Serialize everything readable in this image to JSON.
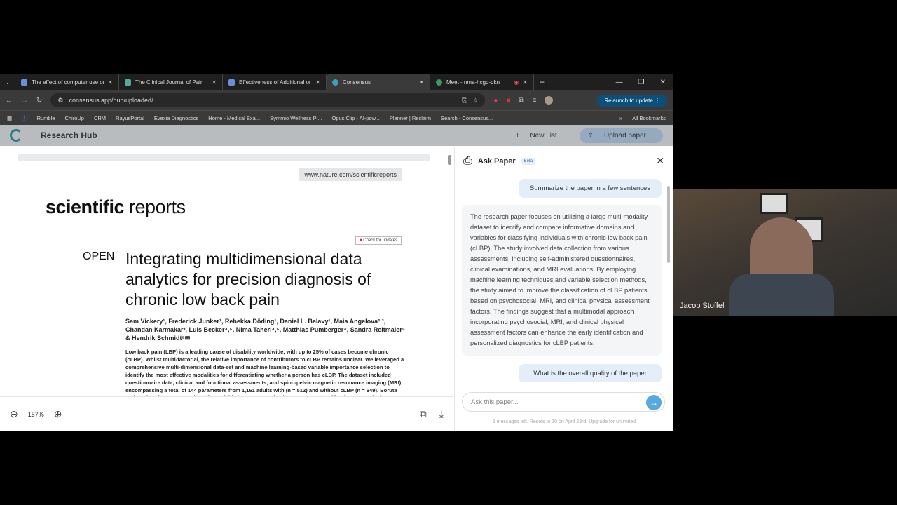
{
  "tabs": [
    {
      "title": "The effect of computer use on"
    },
    {
      "title": "The Clinical Journal of Pain"
    },
    {
      "title": "Effectiveness of Additional or S"
    },
    {
      "title": "Consensus"
    },
    {
      "title": "Meet - nma-hcgd-dkn"
    }
  ],
  "address": {
    "url": "consensus.app/hub/uploaded/",
    "relaunch": "Relaunch to update"
  },
  "bookmarks": [
    "Rumble",
    "ChiroUp",
    "CRM",
    "RayusPortal",
    "Evexia Diagnostics",
    "Home - Medical Exa...",
    "Symmio Wellness Pl...",
    "Opus Clip - AI-pow...",
    "Planner | Reclaim",
    "Search - Consensus...",
    "All Bookmarks"
  ],
  "hub": {
    "title": "Research Hub",
    "new_list": "New List",
    "upload": "Upload paper"
  },
  "pdf": {
    "site": "www.nature.com/scientificreports",
    "journal_bold": "scientific",
    "journal_rest": " reports",
    "check": "Check for updates",
    "open": "OPEN",
    "title": "Integrating multidimensional data analytics for precision diagnosis of chronic low back pain",
    "authors": "Sam Vickery¹, Frederick Junker¹, Rebekka Döding¹, Daniel L. Belavy¹, Maia Angelova²,³, Chandan Karmakar³, Luis Becker⁴,⁵, Nima Taheri⁴,⁵, Matthias Pumberger⁴, Sandra Reitmaier⁵ & Hendrik Schmidt⁵✉",
    "abstract": "Low back pain (LBP) is a leading cause of disability worldwide, with up to 25% of cases become chronic (cLBP). Whilst multi-factorial, the relative importance of contributors to cLBP remains unclear. We leveraged a comprehensive multi-dimensional data-set and machine learning-based variable importance selection to identify the most effective modalities for differentiating whether a person has cLBP. The dataset included questionnaire data, clinical and functional assessments, and spino-pelvic magnetic resonance imaging (MRI), encompassing a total of 144 parameters from 1,161 adults with (n = 512) and without cLBP (n = 649). Boruta and random forest were utilised for variable importance selection and cLBP classification respectively. A multimodal model including questionnaire, clinical",
    "zoom": "157%"
  },
  "ask": {
    "title": "Ask Paper",
    "beta": "Beta",
    "q1": "Summarize the paper in a few sentences",
    "a1": "The research paper focuses on utilizing a large multi-modality dataset to identify and compare informative domains and variables for classifying individuals with chronic low back pain (cLBP). The study involved data collection from various assessments, including self-administered questionnaires, clinical examinations, and MRI evaluations. By employing machine learning techniques and variable selection methods, the study aimed to improve the classification of cLBP patients based on psychosocial, MRI, and clinical physical assessment factors. The findings suggest that a multimodal approach incorporating psychosocial, MRI, and clinical physical assessment factors can enhance the early identification and personalized diagnostics for cLBP patients.",
    "q2": "What is the overall quality of the paper",
    "placeholder": "Ask this paper...",
    "footer": "5 messages left. Resets to 10 on April 23rd.",
    "upgrade": "Upgrade for unlimited"
  },
  "webcam": {
    "name": "Jacob Stoffel"
  }
}
